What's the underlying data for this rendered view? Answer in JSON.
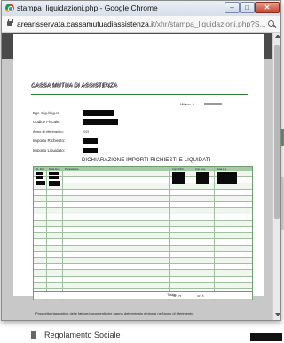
{
  "window": {
    "title": "stampa_liquidazioni.php - Google Chrome",
    "url_host": "arearisservata.cassamutuadiassistenza.it",
    "url_path": "/xhr/stampa_liquidazioni.php?S..."
  },
  "document": {
    "org_title": "CASSA MUTUA DI ASSISTENZA",
    "place_date_prefix": "Milano, li",
    "fields": [
      {
        "label": "Egr. Sig./Sig.ra"
      },
      {
        "label": "Codice Fiscale:"
      },
      {
        "label": "Anno di riferimento:",
        "value": "2019"
      },
      {
        "label": "Importo Richiesto:"
      },
      {
        "label": "Importo Liquidato:"
      }
    ],
    "section_title": "DICHIARAZIONE IMPORTI RICHIESTI E LIQUIDATI",
    "table": {
      "headers": [
        "N. Doc.",
        "Data Doc.",
        "Prestazione",
        "Imp. Rich.",
        "Imp. Liq.",
        "Data Liq."
      ],
      "total_label": "Totale:",
      "total_requested": "327,75",
      "total_liquidated": "307,5"
    },
    "footnote": "Prospetto riassuntivo delle fatture/documenti che hanno determinato rimborsi nell'anno di riferimento."
  },
  "background": {
    "link_label": "Regolamento Sociale"
  },
  "colors": {
    "table_header": "#a7c9a7",
    "table_border": "#6f9f6f",
    "rule_green": "#2e7d32",
    "pdf_toolbar": "#4a4a4a"
  }
}
